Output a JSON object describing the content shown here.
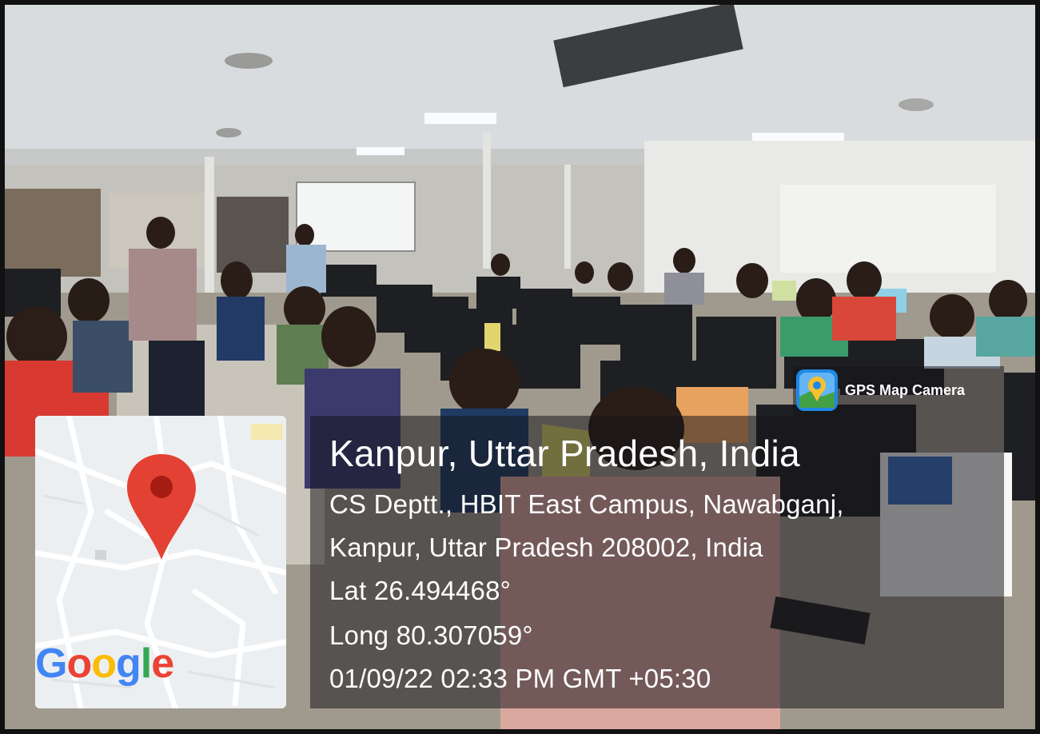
{
  "location": {
    "title": "Kanpur, Uttar Pradesh, India",
    "address_line_1": "CS Deptt., HBIT East Campus, Nawabganj,",
    "address_line_2": "Kanpur, Uttar Pradesh 208002, India",
    "latitude": "Lat 26.494468°",
    "longitude": "Long 80.307059°",
    "datetime": "01/09/22 02:33 PM GMT +05:30"
  },
  "badge": {
    "label": "GPS Map Camera",
    "icon": "gps-map-camera-icon"
  },
  "map": {
    "provider": "Google",
    "marker_icon": "map-pin-icon",
    "colors": {
      "pin": "#e34133",
      "pin_dot": "#a51c12"
    }
  },
  "google_letters": [
    {
      "ch": "G",
      "color": "#4285F4"
    },
    {
      "ch": "o",
      "color": "#EA4335"
    },
    {
      "ch": "o",
      "color": "#FBBC05"
    },
    {
      "ch": "g",
      "color": "#4285F4"
    },
    {
      "ch": "l",
      "color": "#34A853"
    },
    {
      "ch": "e",
      "color": "#EA4335"
    }
  ]
}
